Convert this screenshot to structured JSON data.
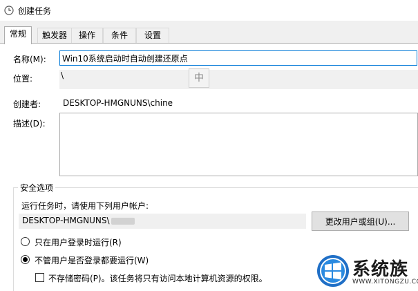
{
  "window": {
    "title": "创建任务",
    "icon": "clock-icon"
  },
  "tabs": [
    {
      "label": "常规",
      "active": true
    },
    {
      "label": "触发器",
      "active": false
    },
    {
      "label": "操作",
      "active": false
    },
    {
      "label": "条件",
      "active": false
    },
    {
      "label": "设置",
      "active": false
    }
  ],
  "general": {
    "name_label": "名称(M):",
    "name_value": "Win10系统启动时自动创建还原点",
    "location_label": "位置:",
    "location_value": "\\",
    "ime_indicator": "中",
    "author_label": "创建者:",
    "author_value": "DESKTOP-HMGNUNS\\chine",
    "description_label": "描述(D):",
    "description_value": ""
  },
  "security": {
    "group_label": "安全选项",
    "run_as_text": "运行任务时，请使用下列用户帐户:",
    "account_value": "DESKTOP-HMGNUNS\\",
    "change_user_button": "更改用户或组(U)...",
    "option_logged_on": "只在用户登录时运行(R)",
    "option_logged_on_checked": false,
    "option_any": "不管用户是否登录都要运行(W)",
    "option_any_checked": true,
    "no_store_password": "不存储密码(P)。该任务将只有访问本地计算机资源的权限。",
    "no_store_password_checked": false
  },
  "watermark": {
    "logo_icon": "windows-logo-icon",
    "title": "系统族",
    "url": "WWW.XITONGZU.COM"
  }
}
